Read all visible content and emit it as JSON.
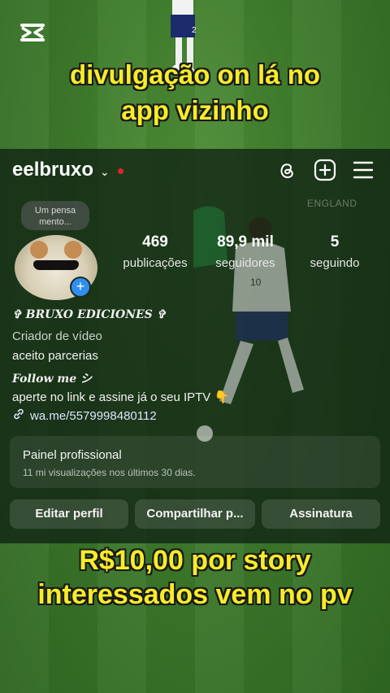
{
  "captions": {
    "top_line1": "divulgação on lá no",
    "top_line2": "app vizinho",
    "bottom_line1": "R$10,00 por story",
    "bottom_line2": "interessados vem no pv"
  },
  "profile": {
    "username": "eelbruxo",
    "note_line1": "Um pensa",
    "note_line2": "mento...",
    "watermark": "ENGLAND",
    "stats": [
      {
        "value": "469",
        "label": "publicações"
      },
      {
        "value": "89,9 mil",
        "label": "seguidores"
      },
      {
        "value": "5",
        "label": "seguindo"
      }
    ],
    "display_name": "✞ BRUXO EDICIONES ✞",
    "category": "Criador de vídeo",
    "bio_line1": "aceito parcerias",
    "bio_follow": "Follow me シ",
    "bio_line2": "aperte no link e assine já o seu IPTV 👇",
    "link": "wa.me/5579998480112"
  },
  "professional_panel": {
    "title": "Painel profissional",
    "subtitle": "11 mi visualizações nos últimos 30 dias."
  },
  "buttons": {
    "edit": "Editar perfil",
    "share": "Compartilhar p...",
    "subscription": "Assinatura"
  },
  "icons": [
    "capcut-logo-icon",
    "chevron-down-icon",
    "threads-icon",
    "add-post-icon",
    "menu-icon",
    "add-story-icon",
    "link-icon"
  ],
  "colors": {
    "caption": "#f7ec2a",
    "notification_dot": "#e0242b",
    "add_badge": "#2f8ff0"
  }
}
